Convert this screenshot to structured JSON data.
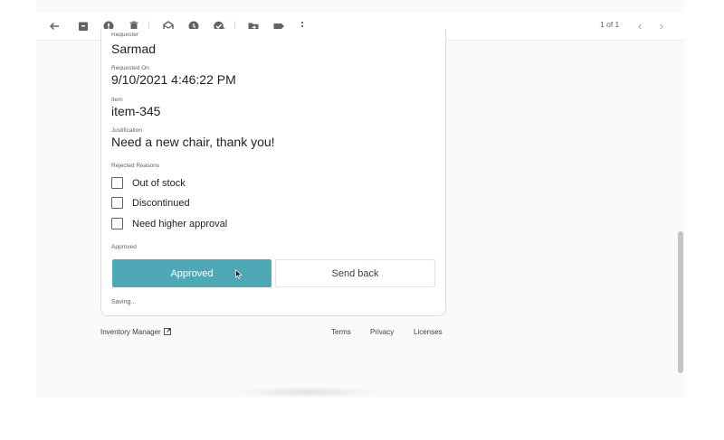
{
  "toolbar": {
    "icons": [
      "back-arrow-icon",
      "archive-icon",
      "report-spam-icon",
      "delete-icon",
      "mark-unread-icon",
      "snooze-icon",
      "add-to-tasks-icon",
      "move-to-icon",
      "label-icon",
      "more-vert-icon"
    ],
    "pager_text": "1 of 1"
  },
  "card": {
    "requester_label": "Requester",
    "requester_value": "Sarmad",
    "requested_on_label": "Requested On",
    "requested_on_value": "9/10/2021 4:46:22 PM",
    "item_label": "Item",
    "item_value": "item-345",
    "justification_label": "Justification",
    "justification_value": "Need a new chair, thank you!",
    "rejected_reasons_label": "Rejected Reasons",
    "reasons": [
      {
        "label": "Out of stock",
        "checked": false
      },
      {
        "label": "Discontinued",
        "checked": false
      },
      {
        "label": "Need higher approval",
        "checked": false
      }
    ],
    "status_label": "Approved",
    "approved_button": "Approved",
    "send_back_button": "Send back",
    "saving_text": "Saving..."
  },
  "footer": {
    "app_link": "Inventory Manager",
    "terms": "Terms",
    "privacy": "Privacy",
    "licenses": "Licenses"
  },
  "colors": {
    "accent": "#4ea9b7",
    "icon": "#5f6368"
  }
}
